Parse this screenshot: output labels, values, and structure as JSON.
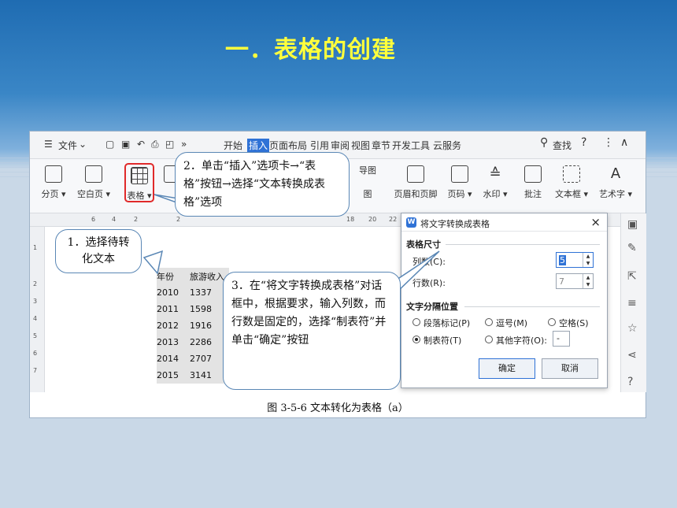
{
  "slide": {
    "title": "一．表格的创建",
    "accent_color": "#ffff3c"
  },
  "toolbar": {
    "menu_icon": "menu-icon",
    "file_label": "文件",
    "tabs": [
      "开始",
      "插入",
      "页面布局",
      "引用",
      "审阅",
      "视图",
      "章节",
      "开发工具",
      "云服务"
    ],
    "search_label": "查找",
    "help_label": "?",
    "more_label": "⋮",
    "collapse_label": "∧"
  },
  "ribbon": {
    "page_break": "分页",
    "blank_page": "空白页",
    "table": "表格",
    "header_footer": "页眉和页脚",
    "page_number": "页码",
    "watermark": "水印",
    "comment": "批注",
    "text_box": "文本框",
    "word_art": "艺术字",
    "mind_map": "导图",
    "chart": "图"
  },
  "ruler": {
    "ticks": [
      "6",
      "4",
      "2",
      "2",
      "18",
      "20",
      "22"
    ],
    "vticks": [
      "1",
      "2",
      "3",
      "4",
      "5",
      "6",
      "7"
    ]
  },
  "document": {
    "header_row": [
      "年份",
      "旅游收入"
    ],
    "rows": [
      [
        "2010",
        "1337"
      ],
      [
        "2011",
        "1598"
      ],
      [
        "2012",
        "1916"
      ],
      [
        "2013",
        "2286"
      ],
      [
        "2014",
        "2707"
      ],
      [
        "2015",
        "3141"
      ]
    ]
  },
  "callouts": {
    "step1": "1．选择待转化文本",
    "step2": "2．单击“插入”选项卡→“表格”按钮→选择“文本转换成表格”选项",
    "step3": "3．在“将文字转换成表格”对话框中，根据要求，输入列数，而行数是固定的，选择“制表符”并单击“确定”按钮"
  },
  "dialog": {
    "title": "将文字转换成表格",
    "size_section": "表格尺寸",
    "columns_label": "列数(C):",
    "columns_value": "5",
    "rows_label": "行数(R):",
    "rows_value": "7",
    "separator_section": "文字分隔位置",
    "opt_paragraph": "段落标记(P)",
    "opt_comma": "逗号(M)",
    "opt_space": "空格(S)",
    "opt_tab": "制表符(T)",
    "opt_other": "其他字符(O):",
    "other_value": "-",
    "ok": "确定",
    "cancel": "取消"
  },
  "figure_caption": "图 3-5-6  文本转化为表格（a）"
}
